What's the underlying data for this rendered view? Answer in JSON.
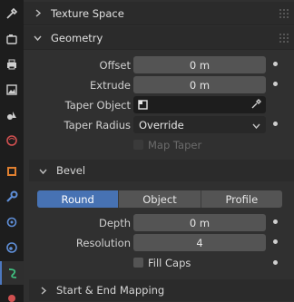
{
  "tabs": [
    {
      "icon": "wrench-screwdriver-icon"
    },
    {
      "icon": "camera-render-icon"
    },
    {
      "icon": "printer-output-icon"
    },
    {
      "icon": "image-view-layer-icon"
    },
    {
      "icon": "scene-shapes-icon"
    },
    {
      "icon": "world-globe-icon"
    },
    {
      "icon": "object-square-icon"
    },
    {
      "icon": "modifier-wrench-icon"
    },
    {
      "icon": "particles-icon"
    },
    {
      "icon": "physics-orbit-icon"
    },
    {
      "icon": "constraint-icon"
    },
    {
      "icon": "curve-data-icon"
    }
  ],
  "panels": {
    "texture_space": "Texture Space",
    "geometry": "Geometry",
    "bevel": "Bevel",
    "start_end_mapping": "Start & End Mapping"
  },
  "geometry": {
    "offset_label": "Offset",
    "offset_value": "0 m",
    "extrude_label": "Extrude",
    "extrude_value": "0 m",
    "taper_object_label": "Taper Object",
    "taper_radius_label": "Taper Radius",
    "taper_radius_value": "Override",
    "map_taper_label": "Map Taper"
  },
  "bevel": {
    "modes": [
      "Round",
      "Object",
      "Profile"
    ],
    "active_mode": "Round",
    "depth_label": "Depth",
    "depth_value": "0 m",
    "resolution_label": "Resolution",
    "resolution_value": "4",
    "fill_caps_label": "Fill Caps"
  },
  "colors": {
    "accent": "#4772b3",
    "field": "#545454",
    "panel": "#303030"
  }
}
